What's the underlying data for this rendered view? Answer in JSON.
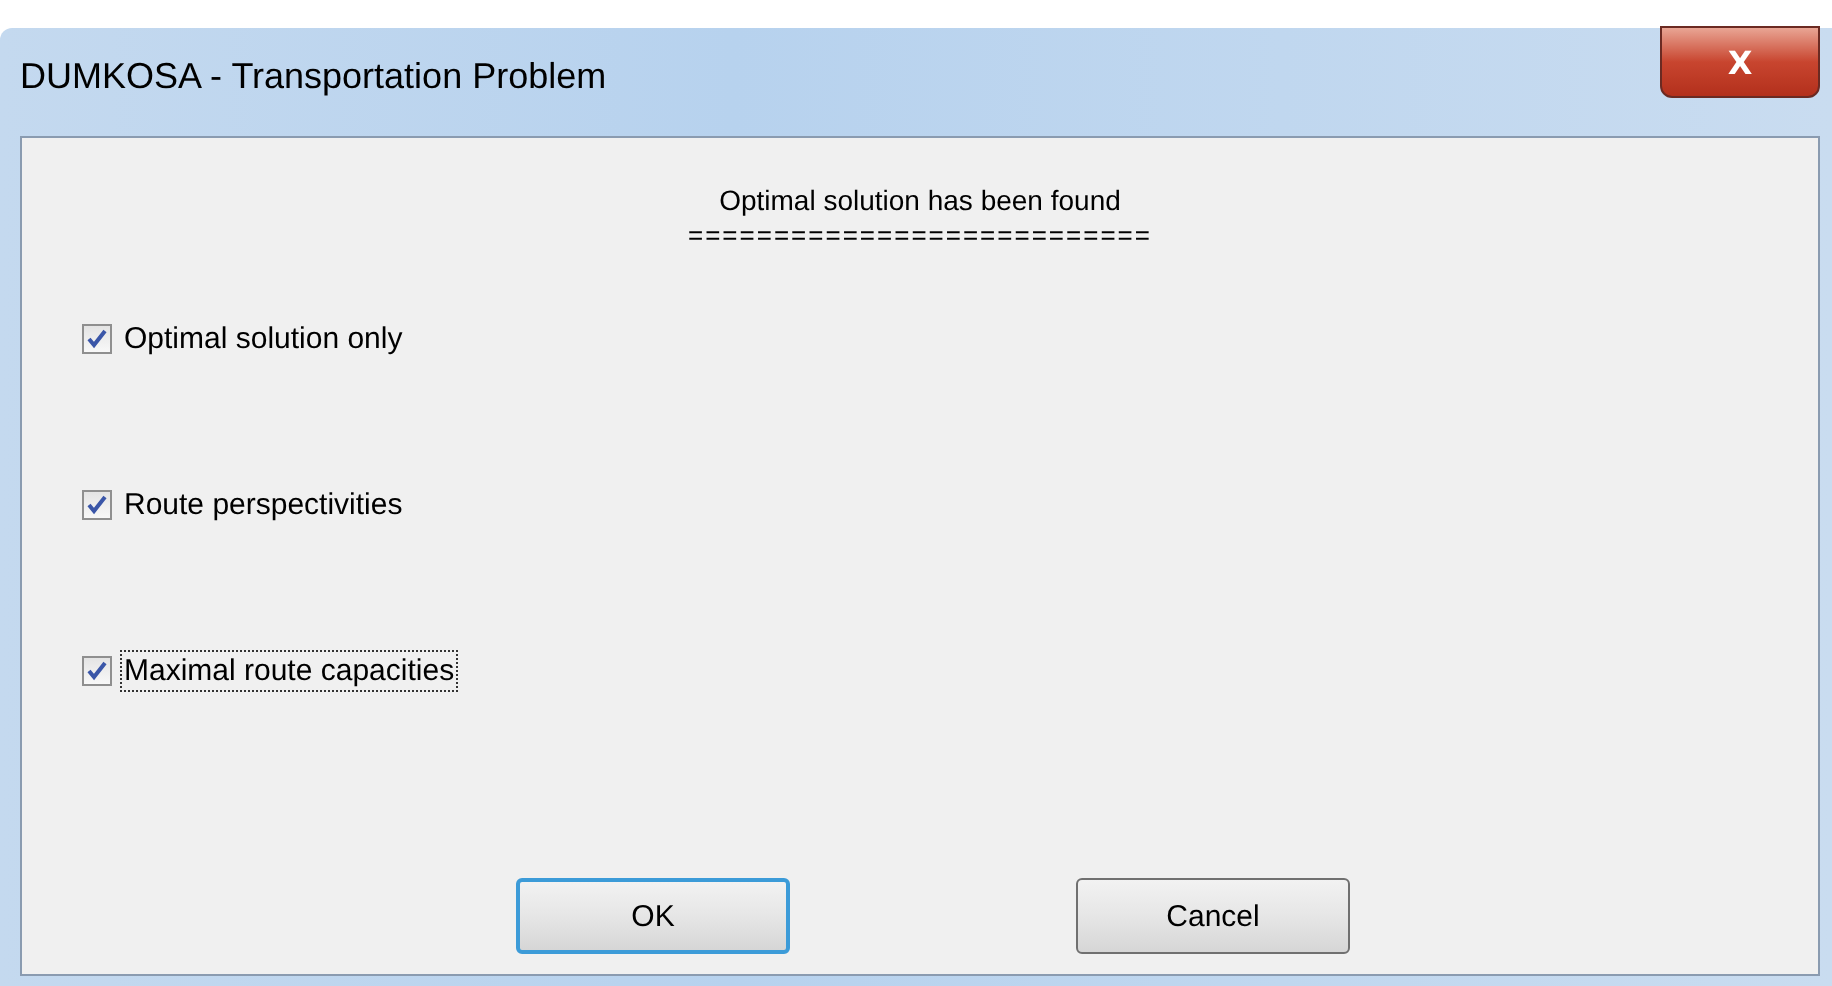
{
  "window": {
    "title": "DUMKOSA - Transportation Problem",
    "close_label": "X"
  },
  "message": {
    "title": "Optimal solution has been found",
    "rule": "==========================="
  },
  "options": [
    {
      "label": "Optimal solution only",
      "checked": true,
      "focused": false
    },
    {
      "label": "Route perspectivities",
      "checked": true,
      "focused": false
    },
    {
      "label": "Maximal route capacities",
      "checked": true,
      "focused": true
    }
  ],
  "buttons": [
    {
      "label": "OK",
      "default": true
    },
    {
      "label": "Cancel",
      "default": false
    }
  ]
}
